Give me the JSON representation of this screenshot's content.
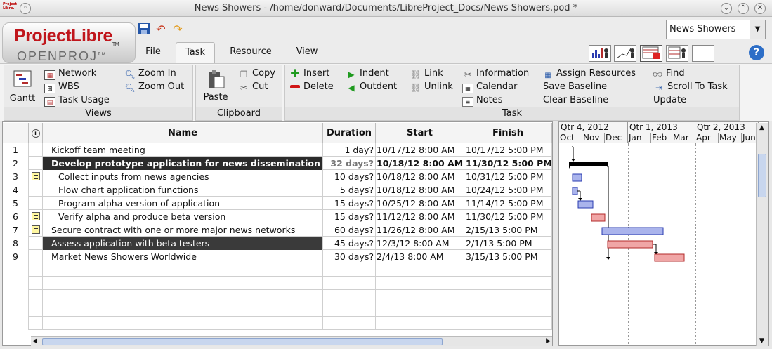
{
  "window": {
    "title": "News Showers - /home/donward/Documents/LibreProject_Docs/News Showers.pod *",
    "logo_text": "Project Libre."
  },
  "app": {
    "logo_main": "ProjectLibre",
    "logo_tm": "TM",
    "logo_sub": "OPENPROJ",
    "logo_sub_tm": "TM"
  },
  "menu": {
    "tabs": [
      "File",
      "Task",
      "Resource",
      "View"
    ],
    "active": "Task"
  },
  "project_selector": {
    "value": "News Showers"
  },
  "ribbon": {
    "views": {
      "label": "Views",
      "gantt": "Gantt",
      "network": "Network",
      "wbs": "WBS",
      "task_usage": "Task Usage",
      "zoom_in": "Zoom In",
      "zoom_out": "Zoom Out"
    },
    "clipboard": {
      "label": "Clipboard",
      "paste": "Paste",
      "copy": "Copy",
      "cut": "Cut"
    },
    "task": {
      "label": "Task",
      "insert": "Insert",
      "delete": "Delete",
      "indent": "Indent",
      "outdent": "Outdent",
      "link": "Link",
      "unlink": "Unlink",
      "information": "Information",
      "calendar": "Calendar",
      "notes": "Notes",
      "assign_resources": "Assign Resources",
      "save_baseline": "Save Baseline",
      "clear_baseline": "Clear Baseline",
      "find": "Find",
      "scroll_to_task": "Scroll To Task",
      "update": "Update"
    }
  },
  "table": {
    "columns": {
      "name": "Name",
      "duration": "Duration",
      "start": "Start",
      "finish": "Finish"
    },
    "rows": [
      {
        "num": "1",
        "name": "Kickoff team meeting",
        "duration": "1 day?",
        "start": "10/17/12 8:00 AM",
        "finish": "10/17/12 5:00 PM",
        "note": false
      },
      {
        "num": "2",
        "name": "Develop prototype application for news dissemination",
        "duration": "32 days?",
        "start": "10/18/12 8:00 AM",
        "finish": "11/30/12 5:00 PM",
        "note": false,
        "summary": true
      },
      {
        "num": "3",
        "name": "Collect inputs from news agencies",
        "duration": "10 days?",
        "start": "10/18/12 8:00 AM",
        "finish": "10/31/12 5:00 PM",
        "note": true
      },
      {
        "num": "4",
        "name": "Flow chart application functions",
        "duration": "5 days?",
        "start": "10/18/12 8:00 AM",
        "finish": "10/24/12 5:00 PM",
        "note": false
      },
      {
        "num": "5",
        "name": "Program alpha version of application",
        "duration": "15 days?",
        "start": "10/25/12 8:00 AM",
        "finish": "11/14/12 5:00 PM",
        "note": false
      },
      {
        "num": "6",
        "name": "Verify alpha and produce beta version",
        "duration": "15 days?",
        "start": "11/12/12 8:00 AM",
        "finish": "11/30/12 5:00 PM",
        "note": true
      },
      {
        "num": "7",
        "name": "Secure contract with one or more major news networks",
        "duration": "60 days?",
        "start": "11/26/12 8:00 AM",
        "finish": "2/15/13 5:00 PM",
        "note": true
      },
      {
        "num": "8",
        "name": "Assess application with beta testers",
        "duration": "45 days?",
        "start": "12/3/12 8:00 AM",
        "finish": "2/1/13 5:00 PM",
        "note": false,
        "selected": true
      },
      {
        "num": "9",
        "name": "Market News Showers Worldwide",
        "duration": "30 days?",
        "start": "2/4/13 8:00 AM",
        "finish": "3/15/13 5:00 PM",
        "note": false
      }
    ]
  },
  "gantt": {
    "quarters": [
      "Qtr 4, 2012",
      "Qtr 1, 2013",
      "Qtr 2, 2013"
    ],
    "months": [
      "Oct",
      "Nov",
      "Dec",
      "Jan",
      "Feb",
      "Mar",
      "Apr",
      "May",
      "Jun"
    ]
  }
}
